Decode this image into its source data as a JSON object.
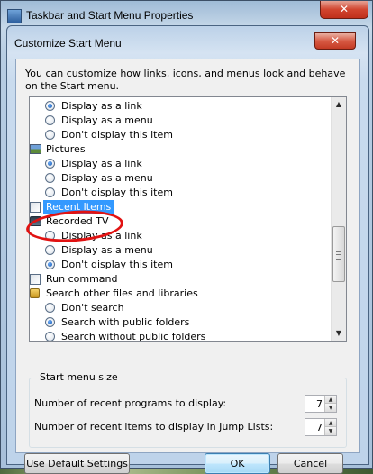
{
  "outer_window": {
    "title": "Taskbar and Start Menu Properties",
    "close_glyph": "✕"
  },
  "dialog": {
    "title": "Customize Start Menu",
    "close_glyph": "✕"
  },
  "description": "You can customize how links, icons, and menus look and behave on the Start menu.",
  "tree_items": [
    {
      "kind": "radio",
      "label": "Display as a link",
      "checked": true
    },
    {
      "kind": "radio",
      "label": "Display as a menu",
      "checked": false
    },
    {
      "kind": "radio",
      "label": "Don't display this item",
      "checked": false
    },
    {
      "kind": "category",
      "icon": "pictures-icon",
      "label": "Pictures"
    },
    {
      "kind": "radio",
      "label": "Display as a link",
      "checked": true
    },
    {
      "kind": "radio",
      "label": "Display as a menu",
      "checked": false
    },
    {
      "kind": "radio",
      "label": "Don't display this item",
      "checked": false
    },
    {
      "kind": "checkbox",
      "label": "Recent Items",
      "checked": false,
      "selected": true
    },
    {
      "kind": "category",
      "icon": "tv-icon",
      "label": "Recorded TV"
    },
    {
      "kind": "radio",
      "label": "Display as a link",
      "checked": false
    },
    {
      "kind": "radio",
      "label": "Display as a menu",
      "checked": false
    },
    {
      "kind": "radio",
      "label": "Don't display this item",
      "checked": true
    },
    {
      "kind": "checkbox",
      "label": "Run command",
      "checked": false
    },
    {
      "kind": "category",
      "icon": "lock-icon",
      "label": "Search other files and libraries"
    },
    {
      "kind": "radio",
      "label": "Don't search",
      "checked": false
    },
    {
      "kind": "radio",
      "label": "Search with public folders",
      "checked": true
    },
    {
      "kind": "radio",
      "label": "Search without public folders",
      "checked": false
    }
  ],
  "scrollbar": {
    "up_glyph": "▲",
    "down_glyph": "▼"
  },
  "start_menu_size": {
    "legend": "Start menu size",
    "recent_programs_label": "Number of recent programs to display:",
    "recent_programs_value": "7",
    "jump_list_label": "Number of recent items to display in Jump Lists:",
    "jump_list_value": "7",
    "spin_up_glyph": "▲",
    "spin_down_glyph": "▼"
  },
  "buttons": {
    "default_label": "Use Default Settings",
    "ok_label": "OK",
    "cancel_label": "Cancel"
  }
}
